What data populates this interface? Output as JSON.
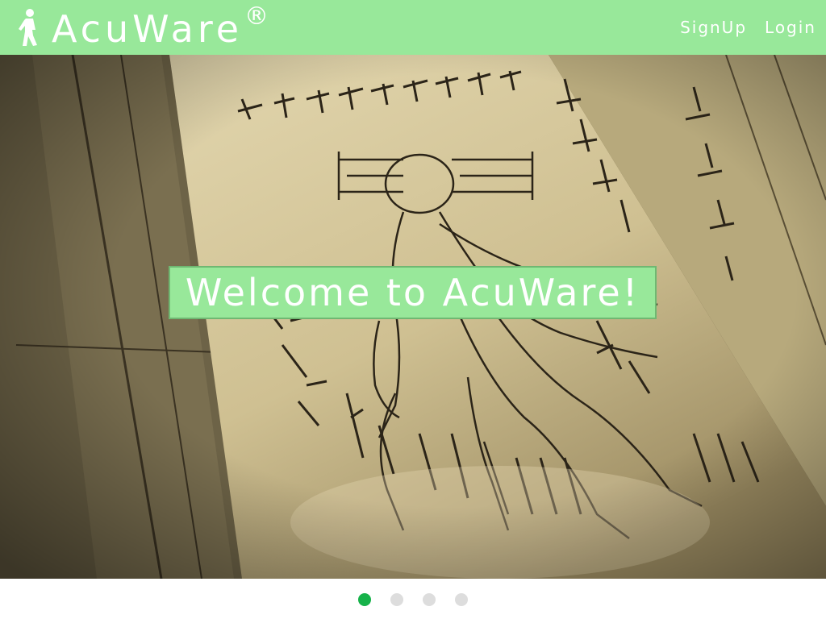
{
  "brand": {
    "name": "AcuWare",
    "registered_mark": "®",
    "icon": "walking-person-icon"
  },
  "nav": {
    "signup_label": "SignUp",
    "login_label": "Login"
  },
  "hero": {
    "image": "ancient-acupuncture-manuscript",
    "welcome_text": "Welcome to AcuWare!"
  },
  "carousel": {
    "slide_count": 4,
    "active_index": 0
  },
  "colors": {
    "navbar": "#98e89a",
    "text": "#ffffff",
    "dot_active": "#16b24a",
    "dot_inactive": "#dddddd"
  }
}
